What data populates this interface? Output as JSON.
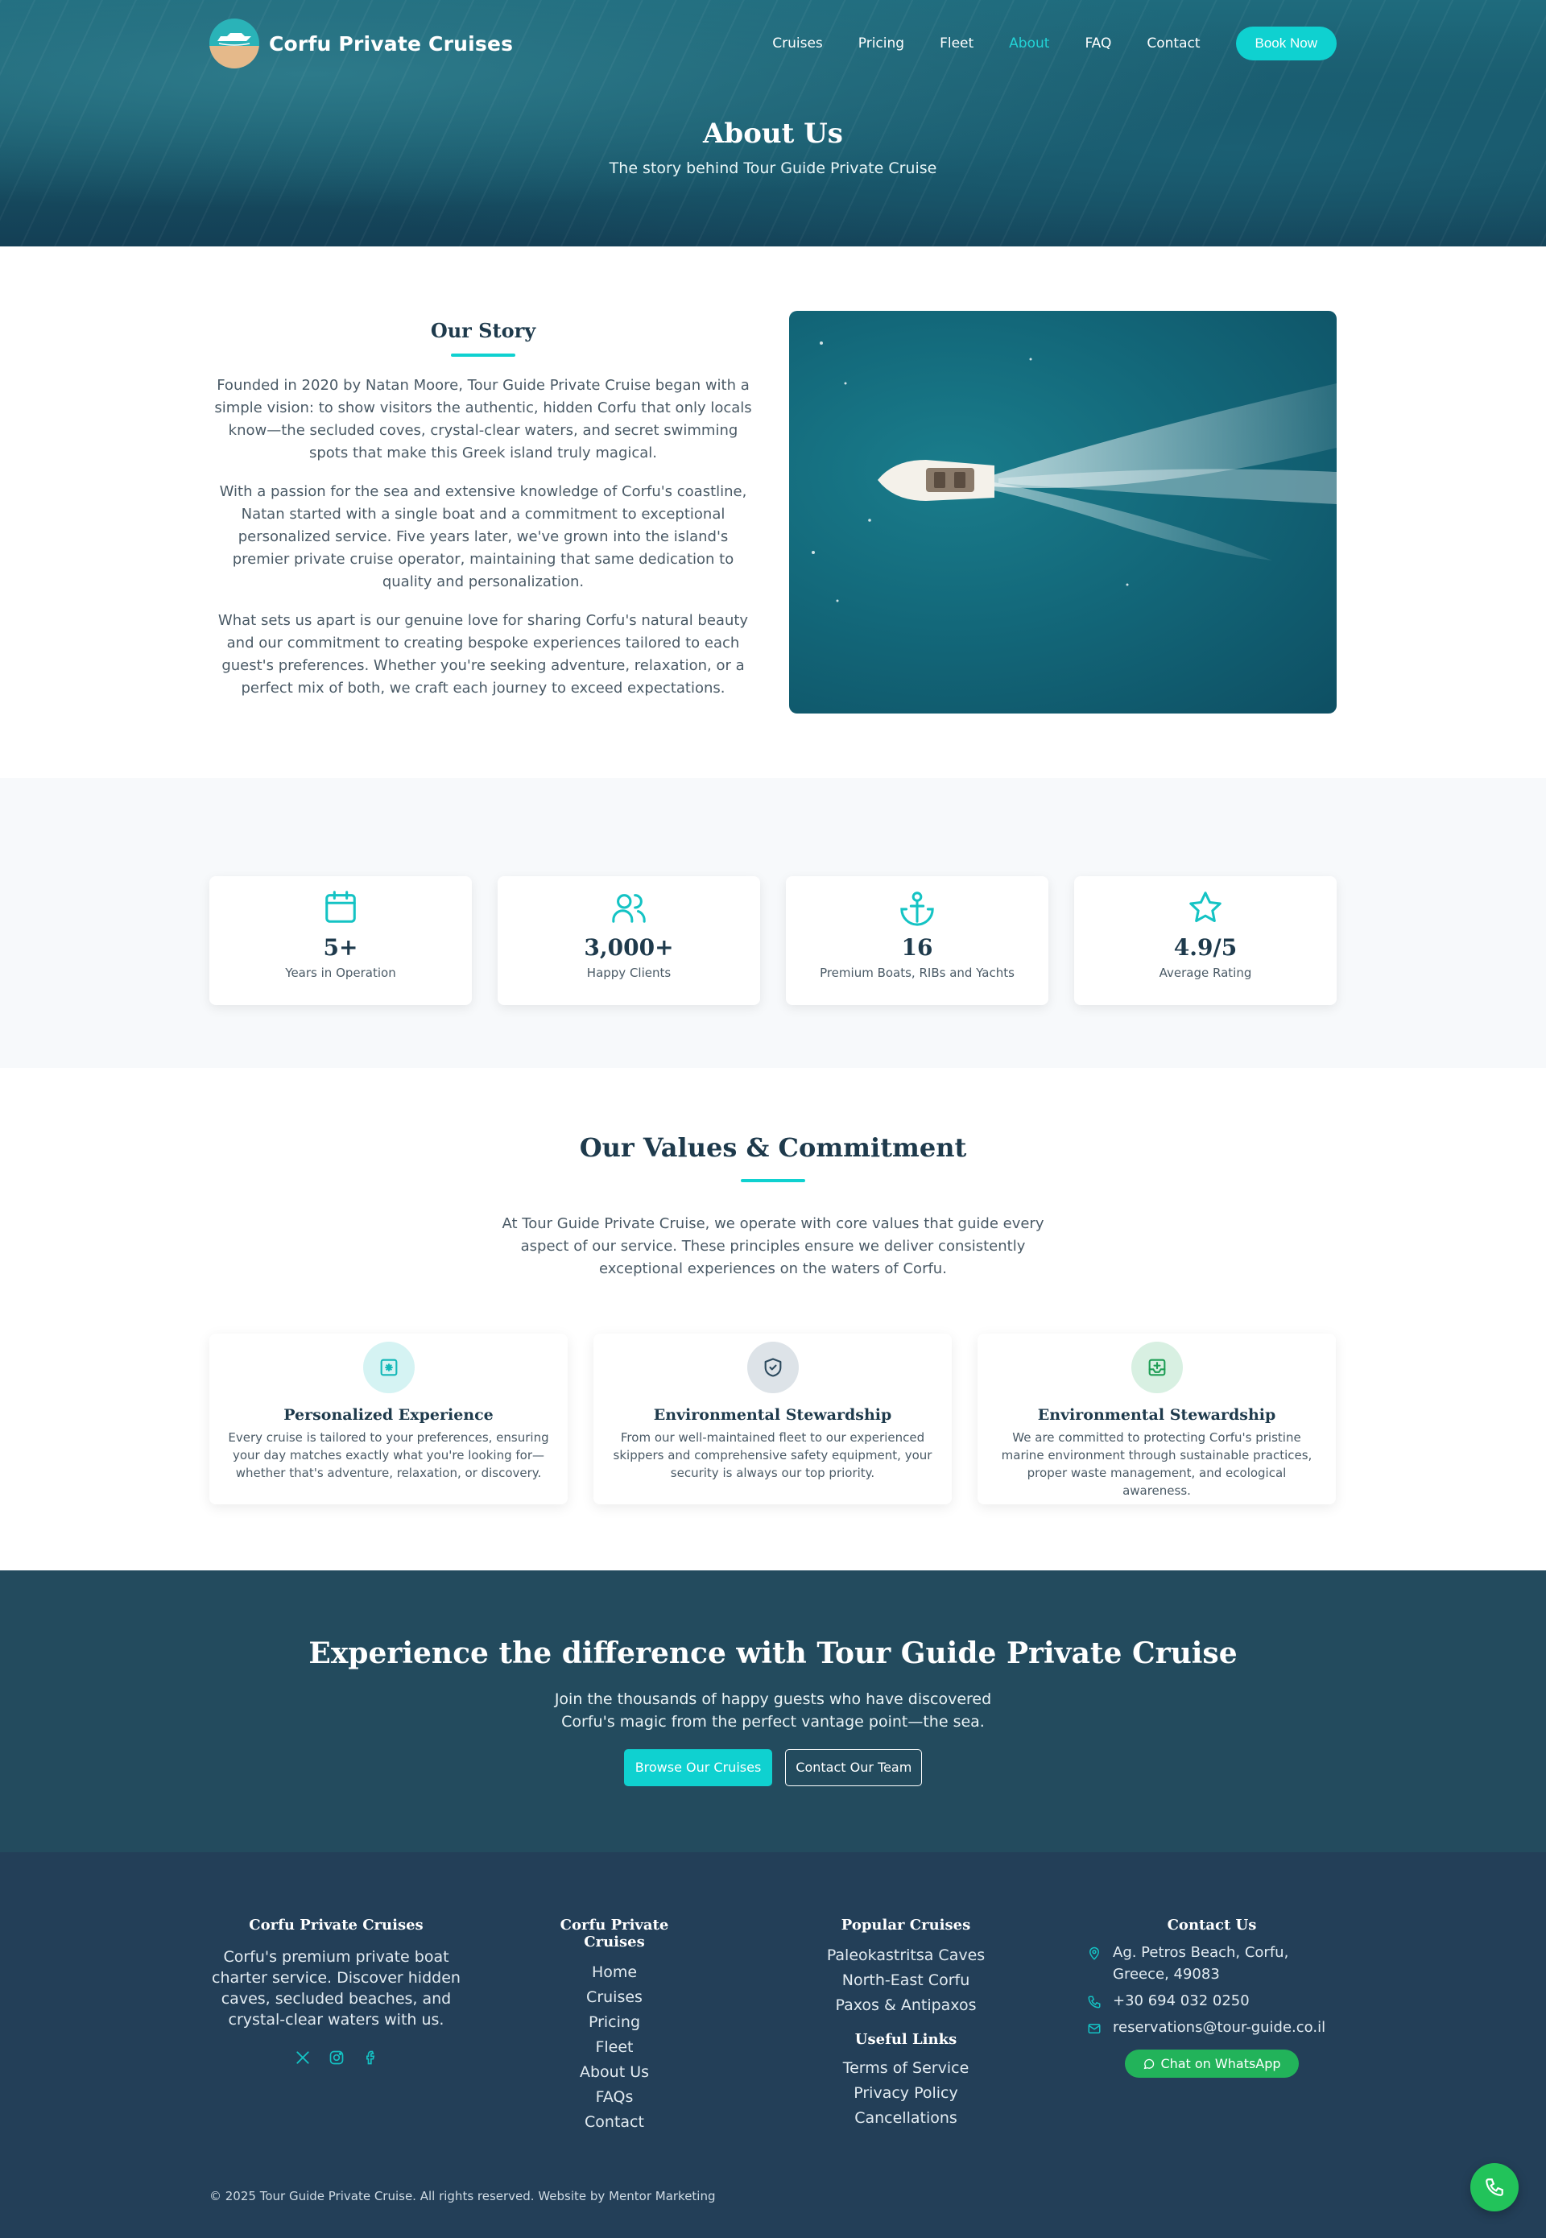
{
  "nav": {
    "brand": "Corfu Private Cruises",
    "items": [
      "Cruises",
      "Pricing",
      "Fleet",
      "About",
      "FAQ",
      "Contact"
    ],
    "active": "About",
    "book_label": "Book Now"
  },
  "hero": {
    "title": "About Us",
    "subtitle": "The story behind Tour Guide Private Cruise"
  },
  "story": {
    "title": "Our Story",
    "paragraphs": [
      "Founded in 2020 by Natan Moore, Tour Guide Private Cruise began with a simple vision: to show visitors the authentic, hidden Corfu that only locals know—the secluded coves, crystal-clear waters, and secret swimming spots that make this Greek island truly magical.",
      "With a passion for the sea and extensive knowledge of Corfu's coastline, Natan started with a single boat and a commitment to exceptional personalized service. Five years later, we've grown into the island's premier private cruise operator, maintaining that same dedication to quality and personalization.",
      "What sets us apart is our genuine love for sharing Corfu's natural beauty and our commitment to creating bespoke experiences tailored to each guest's preferences. Whether you're seeking adventure, relaxation, or a perfect mix of both, we craft each journey to exceed expectations."
    ]
  },
  "stats": [
    {
      "icon": "calendar-icon",
      "value": "5+",
      "label": "Years in Operation"
    },
    {
      "icon": "users-icon",
      "value": "3,000+",
      "label": "Happy Clients"
    },
    {
      "icon": "anchor-icon",
      "value": "16",
      "label": "Premium Boats, RIBs and Yachts"
    },
    {
      "icon": "star-icon",
      "value": "4.9/5",
      "label": "Average Rating"
    }
  ],
  "values": {
    "title": "Our Values & Commitment",
    "intro": "At Tour Guide Private Cruise, we operate with core values that guide every aspect of our service. These principles ensure we deliver consistently exceptional experiences on the waters of Corfu.",
    "cards": [
      {
        "icon": "sparkle-icon",
        "title": "Personalized Experience",
        "desc": "Every cruise is tailored to your preferences, ensuring your day matches exactly what you're looking for—whether that's adventure, relaxation, or discovery.",
        "bg": "#d5f3f3",
        "color": "#14b8b8"
      },
      {
        "icon": "shield-icon",
        "title": "Environmental Stewardship",
        "desc": "From our well-maintained fleet to our experienced skippers and comprehensive safety equipment, your security is always our top priority.",
        "bg": "#dde3e8",
        "color": "#2c4a5e"
      },
      {
        "icon": "leaf-icon",
        "title": "Environmental Stewardship",
        "desc": "We are committed to protecting Corfu's pristine marine environment through sustainable practices, proper waste management, and ecological awareness.",
        "bg": "#d8f0e2",
        "color": "#1f9e55"
      }
    ]
  },
  "cta": {
    "title": "Experience the difference with Tour Guide Private Cruise",
    "text": "Join the thousands of happy guests who have discovered Corfu's magic from the perfect vantage point—the sea.",
    "primary": "Browse Our Cruises",
    "secondary": "Contact Our Team"
  },
  "footer": {
    "about_title": "Corfu Private Cruises",
    "about_text": "Corfu's premium private boat charter service. Discover hidden caves, secluded beaches, and crystal-clear waters with us.",
    "links_title": "Corfu Private Cruises",
    "links": [
      "Home",
      "Cruises",
      "Pricing",
      "Fleet",
      "About Us",
      "FAQs",
      "Contact"
    ],
    "popular_title": "Popular Cruises",
    "popular": [
      "Paleokastritsa Caves",
      "North-East Corfu",
      "Paxos & Antipaxos"
    ],
    "useful_title": "Useful Links",
    "useful": [
      "Terms of Service",
      "Privacy Policy",
      "Cancellations"
    ],
    "contact_title": "Contact Us",
    "address": "Ag. Petros Beach, Corfu, Greece, 49083",
    "phone": "+30 694 032 0250",
    "email": "reservations@tour-guide.co.il",
    "whatsapp": "Chat on WhatsApp",
    "copyright": "© 2025 Tour Guide Private Cruise. All rights reserved. Website by Mentor Marketing"
  },
  "colors": {
    "accent": "#0fd1d0",
    "navy": "#1e3a4c",
    "cta_bg": "#234b5e",
    "footer_bg": "#233f58",
    "whatsapp": "#22b35a"
  }
}
